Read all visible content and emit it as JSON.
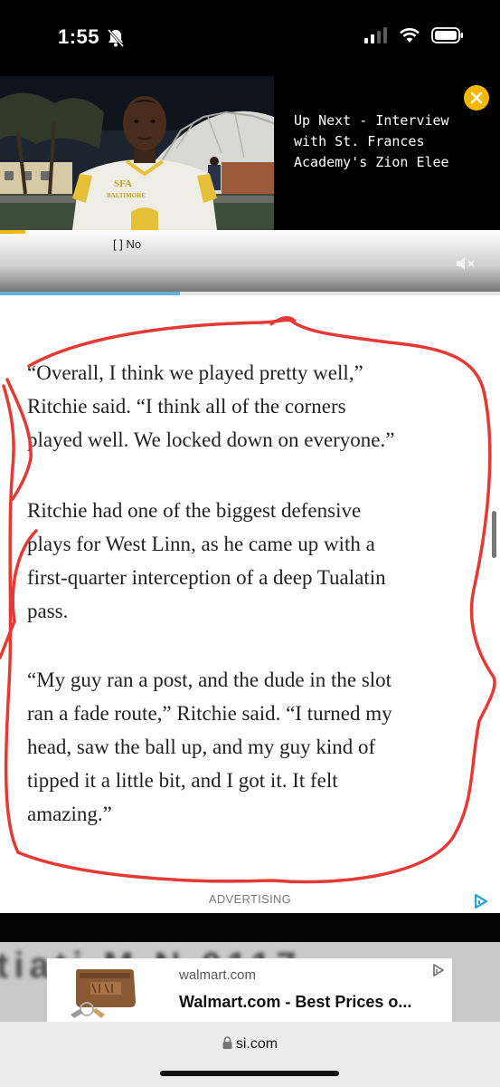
{
  "status_bar": {
    "time": "1:55",
    "icons": [
      "bell-slash-icon",
      "signal-icon",
      "wifi-icon",
      "battery-icon"
    ]
  },
  "video": {
    "up_next_text": "Up Next - Interview with St. Frances Academy's Zion Elee",
    "thumbnail_jersey_lines": [
      "SFA",
      "BALTIMORE"
    ],
    "close_icon": "close-icon",
    "accent_color": "#f5b800",
    "progress_fraction": 0.05
  },
  "player_controls": {
    "captions_text": "[ ] No",
    "mute_icon": "mute-icon"
  },
  "page_progress_fraction": 0.36,
  "article": {
    "paragraphs": [
      [
        "“Overall, I think we played pretty well,”",
        "Ritchie said. “I think all of the corners",
        "played well. We locked down on everyone.”"
      ],
      [
        "Ritchie had one of the biggest defensive",
        "plays for West Linn, as he came up with a",
        "first-quarter interception of a deep Tualatin",
        "pass."
      ],
      [
        "“My guy ran a post, and the dude in the slot",
        "ran a fade route,” Ritchie said. “I turned my",
        "head, saw the ball up, and my guy kind of",
        "tipped it a little bit, and I got it. It felt",
        "amazing.”"
      ]
    ],
    "annotation_color": "#e53935"
  },
  "ad": {
    "label": "ADVERTISING",
    "adchoices_icon": "adchoices-icon",
    "background_text": "tiati     M        N  0117",
    "card_domain": "walmart.com",
    "card_title": "Walmart.com - Best Prices o...",
    "card_arrow_icon": "ad-arrow-icon"
  },
  "browser": {
    "lock_icon": "lock-icon",
    "url": "si.com"
  }
}
